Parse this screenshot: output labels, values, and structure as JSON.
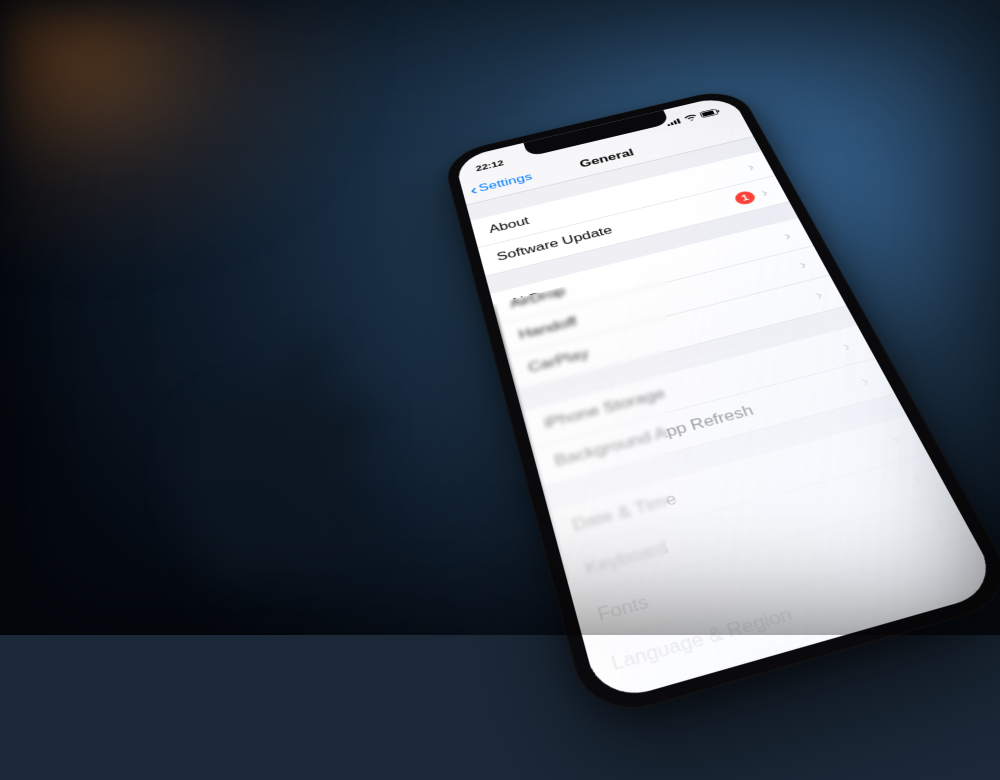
{
  "status_bar": {
    "time": "22:12"
  },
  "nav": {
    "back_label": "Settings",
    "title": "General"
  },
  "sections": [
    {
      "rows": [
        {
          "label": "About",
          "badge": null
        },
        {
          "label": "Software Update",
          "badge": "1"
        }
      ]
    },
    {
      "rows": [
        {
          "label": "AirDrop",
          "badge": null
        },
        {
          "label": "Handoff",
          "badge": null
        },
        {
          "label": "CarPlay",
          "badge": null
        }
      ]
    },
    {
      "rows": [
        {
          "label": "iPhone Storage",
          "badge": null
        },
        {
          "label": "Background App Refresh",
          "badge": null
        }
      ]
    },
    {
      "rows": [
        {
          "label": "Date & Time",
          "badge": null
        },
        {
          "label": "Keyboard",
          "badge": null
        },
        {
          "label": "Fonts",
          "badge": null
        },
        {
          "label": "Language & Region",
          "badge": null
        }
      ]
    }
  ],
  "colors": {
    "ios_blue": "#007aff",
    "ios_red": "#ff3b30",
    "ios_bg": "#efeff4"
  }
}
